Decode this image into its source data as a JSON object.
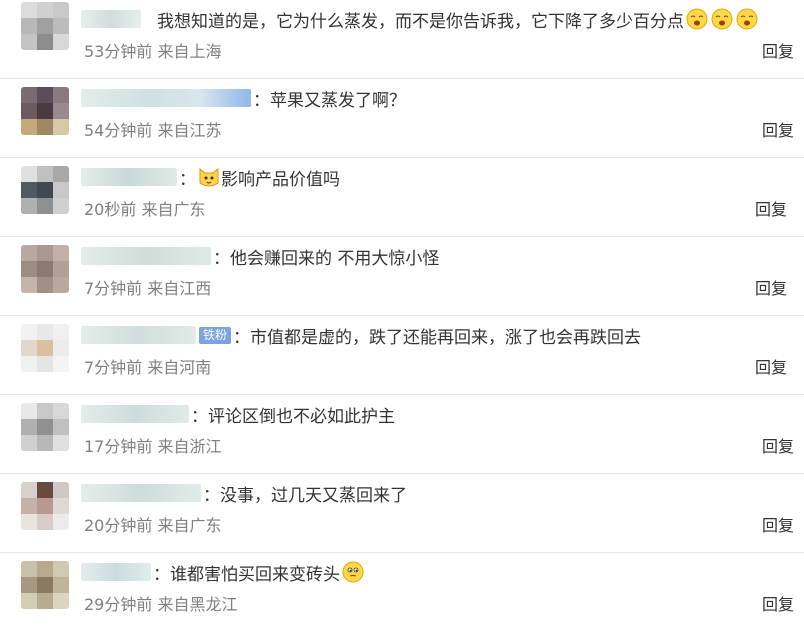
{
  "comments": [
    {
      "text": "我想知道的是，它为什么蒸发，而不是你告诉我，它下降了多少百分点",
      "meta": "53分钟前 来自上海",
      "reply": "回复",
      "tag": ""
    },
    {
      "text": "苹果又蒸发了啊？",
      "meta": "54分钟前 来自江苏",
      "reply": "回复",
      "tag": ""
    },
    {
      "text": "影响产品价值吗",
      "meta": "20秒前 来自广东",
      "reply": "回复",
      "tag": ""
    },
    {
      "text": "他会赚回来的 不用大惊小怪",
      "meta": "7分钟前 来自江西",
      "reply": "回复",
      "tag": ""
    },
    {
      "text": "市值都是虚的，跌了还能再回来，涨了也会再跌回去",
      "meta": "7分钟前 来自河南",
      "reply": "回复",
      "tag": "铁粉"
    },
    {
      "text": "评论区倒也不必如此护主",
      "meta": "17分钟前 来自浙江",
      "reply": "回复",
      "tag": ""
    },
    {
      "text": "没事，过几天又蒸回来了",
      "meta": "20分钟前 来自广东",
      "reply": "回复",
      "tag": ""
    },
    {
      "text": "谁都害怕买回来变砖头",
      "meta": "29分钟前 来自黑龙江",
      "reply": "回复",
      "tag": ""
    }
  ],
  "separator": "：",
  "icons": {
    "row1": [
      "yawn-emoji-icon",
      "yawn-emoji-icon",
      "yawn-emoji-icon"
    ],
    "row3": [
      "cat-emoji-icon"
    ],
    "row8": [
      "thinking-emoji-icon"
    ]
  }
}
